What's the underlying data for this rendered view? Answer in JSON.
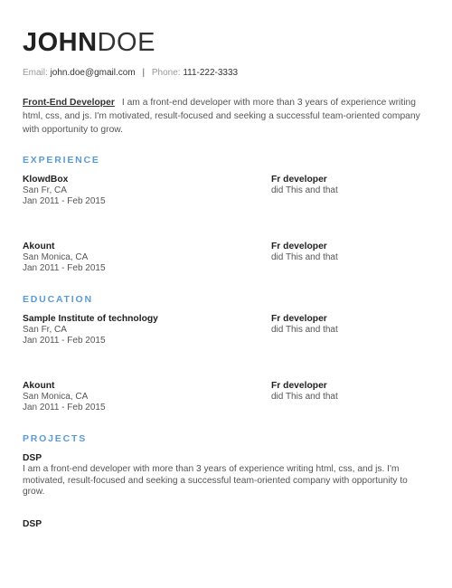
{
  "header": {
    "first_name": "JOHN",
    "last_name": "DOE",
    "email_label": "Email:",
    "email": "john.doe@gmail.com",
    "separator": "|",
    "phone_label": "Phone:",
    "phone": "111-222-3333"
  },
  "summary": {
    "role": "Front-End Developer",
    "text": "I am a front-end developer with more than 3 years of experience writing html, css, and js. I'm motivated, result-focused and seeking a successful team-oriented company with opportunity to grow."
  },
  "experience": {
    "title": "EXPERIENCE",
    "items": [
      {
        "company": "KlowdBox",
        "location": "San Fr, CA",
        "dates": "Jan 2011 - Feb 2015",
        "role": "Fr developer",
        "description": "did This and that"
      },
      {
        "company": "Akount",
        "location": "San Monica, CA",
        "dates": "Jan 2011 - Feb 2015",
        "role": "Fr developer",
        "description": "did This and that"
      }
    ]
  },
  "education": {
    "title": "EDUCATION",
    "items": [
      {
        "school": "Sample Institute of technology",
        "location": "San Fr, CA",
        "dates": "Jan 2011 - Feb 2015",
        "role": "Fr developer",
        "description": "did This and that"
      },
      {
        "school": "Akount",
        "location": "San Monica, CA",
        "dates": "Jan 2011 - Feb 2015",
        "role": "Fr developer",
        "description": "did This and that"
      }
    ]
  },
  "projects": {
    "title": "PROJECTS",
    "items": [
      {
        "name": "DSP",
        "description": "I am a front-end developer with more than 3 years of experience writing html, css, and js. I'm motivated, result-focused and seeking a successful team-oriented company with opportunity to grow."
      },
      {
        "name": "DSP"
      }
    ]
  },
  "colors": {
    "section_title": "#5b9bd5",
    "text": "#555555",
    "heading": "#222222"
  }
}
